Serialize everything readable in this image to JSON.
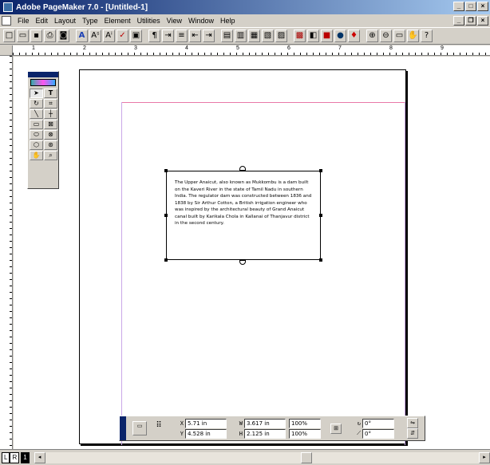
{
  "window": {
    "title": "Adobe PageMaker 7.0 - [Untitled-1]"
  },
  "menu": [
    "File",
    "Edit",
    "Layout",
    "Type",
    "Element",
    "Utilities",
    "View",
    "Window",
    "Help"
  ],
  "toolbar": {
    "icons": [
      "new-icon",
      "open-icon",
      "save-icon",
      "print-icon",
      "find-icon",
      "font-icon",
      "type-size-icon",
      "type-spec-icon",
      "spell-icon",
      "frame-icon",
      "paragraph-icon",
      "indent-icon",
      "bullet-icon",
      "align-left-icon",
      "align-right-icon",
      "styles-icon",
      "colors-icon",
      "layers-icon",
      "links-icon",
      "plug-icon",
      "image-icon",
      "place-icon",
      "color-icon",
      "globe-icon",
      "acrobat-icon",
      "zoom-in-icon",
      "zoom-out-icon",
      "actual-size-icon",
      "hand-icon",
      "help-icon"
    ]
  },
  "ruler": {
    "numbers": [
      "1",
      "2",
      "3",
      "4",
      "5",
      "6",
      "7",
      "8",
      "9"
    ]
  },
  "text_block": {
    "content": "The Upper Anaicut, also known as Mukkombu is a dam built on the Kaveri River in the state of Tamil Nadu in southern India. The regulator dam was constructed between 1836 and 1838 by Sir Arthur Cotton, a British irrigation engineer who was inspired by the architectural beauty of Grand Anaicut canal built by Karikala Chola in Kallanai of Thanjavur district in the second century."
  },
  "control_palette": {
    "x_label": "X",
    "x_value": "5.71 in",
    "y_label": "Y",
    "y_value": "4.528 in",
    "w_label": "W",
    "w_value": "3.617 in",
    "h_label": "H",
    "h_value": "2.125 in",
    "scale_w": "100%",
    "scale_h": "100%",
    "rotation": "0°",
    "skew": "0°"
  },
  "pages": {
    "left": "L",
    "right": "R",
    "current": "1"
  }
}
